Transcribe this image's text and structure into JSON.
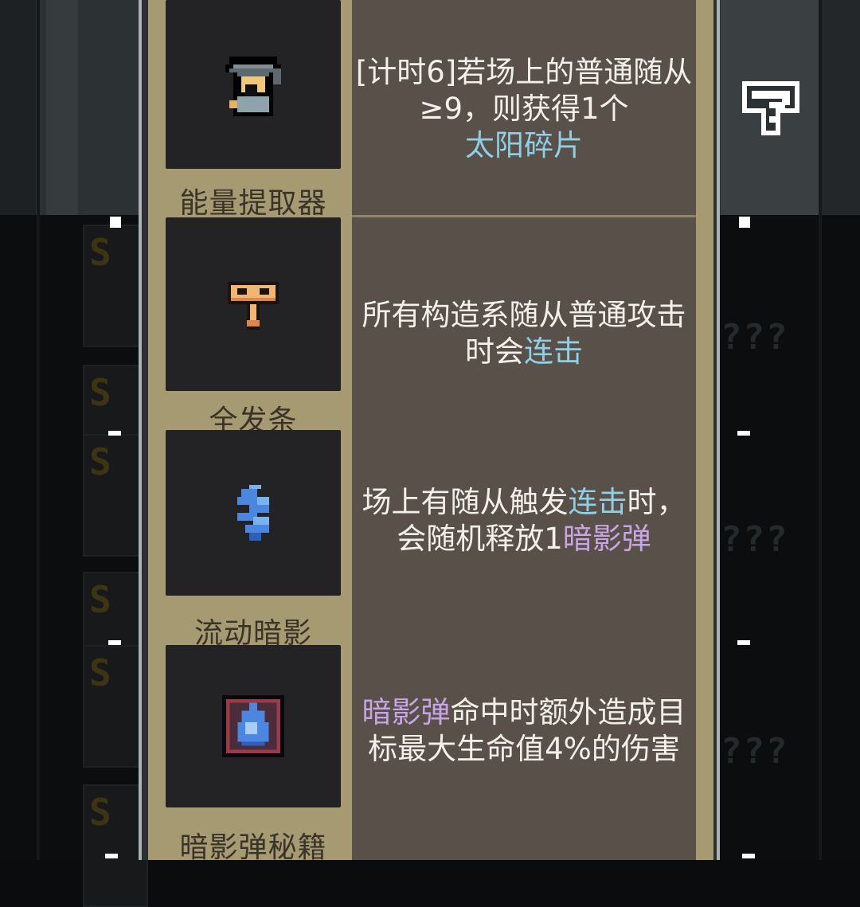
{
  "items": [
    {
      "name": "能量提取器",
      "icon": "hooded-figure-icon",
      "description": [
        {
          "text": "[计时6]若场上的普通随从≥9，则获得1个",
          "style": "normal"
        },
        {
          "text": "太阳碎片",
          "style": "cyan"
        }
      ]
    },
    {
      "name": "全发条",
      "icon": "wind-up-key-icon",
      "description": [
        {
          "text": "所有构造系随从普通攻击时会",
          "style": "normal"
        },
        {
          "text": "连击",
          "style": "cyan"
        }
      ]
    },
    {
      "name": "流动暗影",
      "icon": "shadow-swirl-icon",
      "description": [
        {
          "text": "场上有随从触发",
          "style": "normal"
        },
        {
          "text": "连击",
          "style": "cyan"
        },
        {
          "text": "时，会随机释放1",
          "style": "normal"
        },
        {
          "text": "暗影弹",
          "style": "purple"
        }
      ]
    },
    {
      "name": "暗影弹秘籍",
      "icon": "shadow-flame-tome-icon",
      "description": [
        {
          "text": "暗影弹",
          "style": "purple"
        },
        {
          "text": "命中时额外造成目标最大生命值4%的伤害",
          "style": "normal"
        }
      ]
    }
  ],
  "background": {
    "help_button_icon": "question-mark-icon",
    "card_glyph": "S",
    "unknown_label": "???"
  },
  "colors": {
    "panel_frame": "#a69a73",
    "icon_bg": "#232325",
    "desc_bg": "#585049",
    "keyword_cyan": "#8fd0e6",
    "keyword_purple": "#c7a4e3"
  }
}
